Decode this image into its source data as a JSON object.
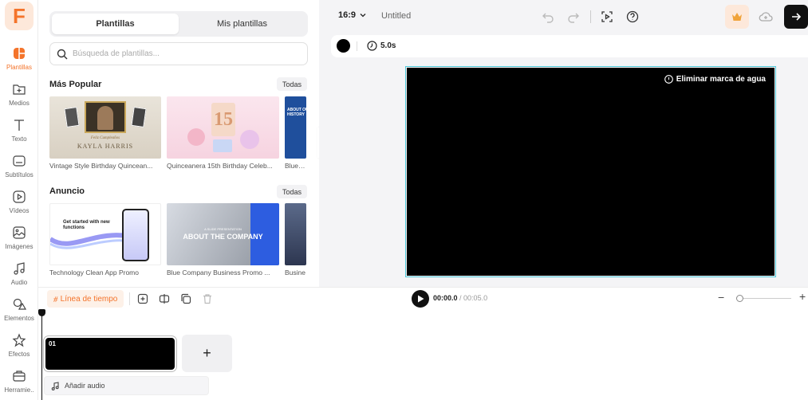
{
  "app": {
    "logo_letter": "F",
    "accent": "#f4742b"
  },
  "rail": {
    "items": [
      {
        "label": "Plantillas",
        "icon": "templates-icon",
        "active": true
      },
      {
        "label": "Medios",
        "icon": "media-add-icon"
      },
      {
        "label": "Texto",
        "icon": "text-icon"
      },
      {
        "label": "Subtítulos",
        "icon": "subtitles-icon"
      },
      {
        "label": "Vídeos",
        "icon": "video-icon"
      },
      {
        "label": "Imágenes",
        "icon": "image-icon"
      },
      {
        "label": "Audio",
        "icon": "music-icon"
      },
      {
        "label": "Elementos",
        "icon": "shapes-icon"
      },
      {
        "label": "Efectos",
        "icon": "effects-icon"
      },
      {
        "label": "Herramie..",
        "icon": "toolbox-icon"
      }
    ]
  },
  "panel": {
    "tabs": [
      "Plantillas",
      "Mis plantillas"
    ],
    "search_placeholder": "Búsqueda de plantillas...",
    "popular": {
      "title": "Más Popular",
      "all": "Todas",
      "items": [
        {
          "caption": "Vintage Style Birthday Quincean...",
          "art_name": "Kayla Harris",
          "art_script": "Feliz Cumpleaños"
        },
        {
          "caption": "Quinceanera 15th Birthday Celeb...",
          "art_number": "15"
        },
        {
          "caption": "Blue Te",
          "art_text": "ABOUT OUR COMPANY HISTORY"
        }
      ]
    },
    "ad": {
      "title": "Anuncio",
      "all": "Todas",
      "items": [
        {
          "caption": "Technology Clean App Promo",
          "art_text": "Get started with new functions"
        },
        {
          "caption": "Blue Company Business Promo ...",
          "art_sub": "A SLIDE PRESENTATION",
          "art_text": "ABOUT THE COMPANY"
        },
        {
          "caption": "Busine"
        }
      ]
    }
  },
  "topbar": {
    "ratio": "16:9",
    "title": "Untitled"
  },
  "subbar": {
    "duration": "5.0s"
  },
  "canvas": {
    "watermark": "Eliminar marca de agua"
  },
  "timeline": {
    "tab": "Línea de tiempo",
    "current_time": "00:00.0",
    "total_time": "/ 00:05.0",
    "clip_label": "01",
    "add_audio": "Añadir audio"
  }
}
